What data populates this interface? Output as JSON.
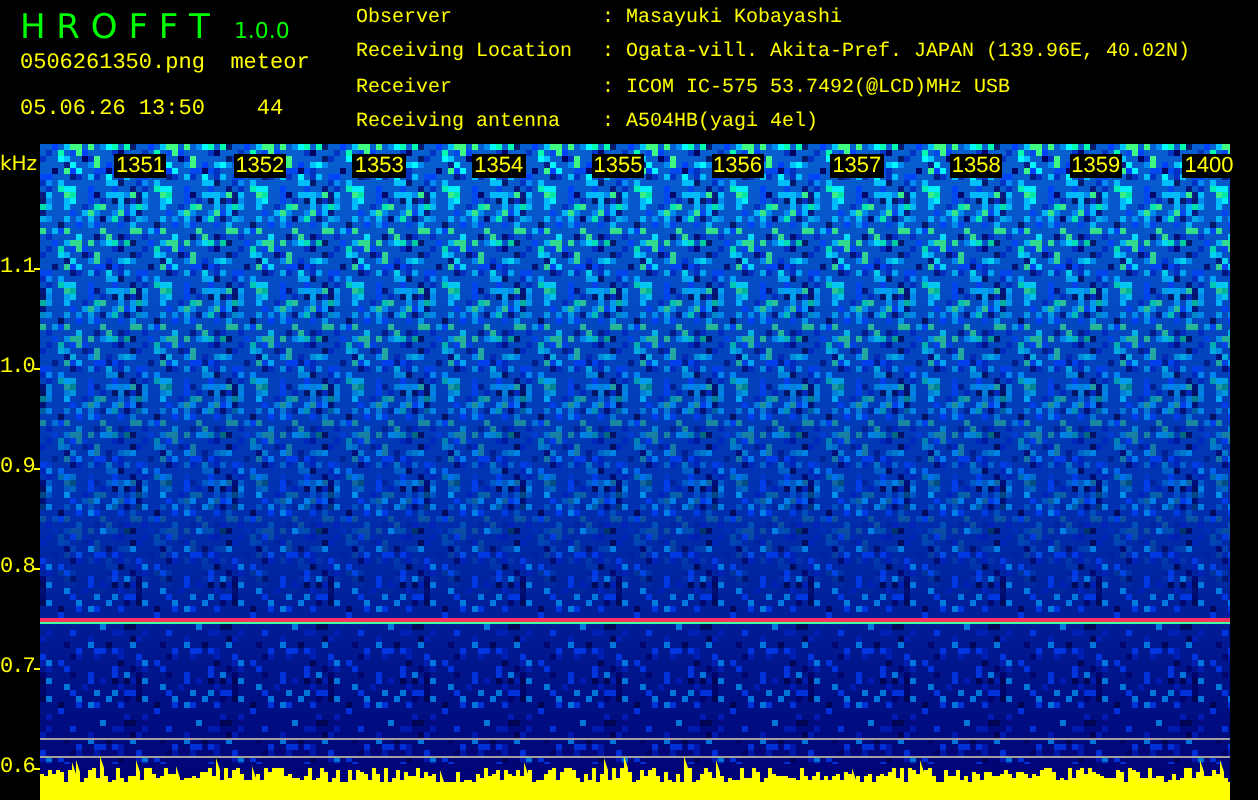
{
  "app": {
    "name": "H R O F F T",
    "version": "1.0.0"
  },
  "file": "0506261350.png",
  "timestamp": "05.06.26 13:50",
  "meteor": {
    "label": "meteor",
    "count": "44"
  },
  "info": [
    {
      "label": "Observer",
      "sep": ":",
      "value": "Masayuki Kobayashi"
    },
    {
      "label": "Receiving Location",
      "sep": ":",
      "value": "Ogata-vill. Akita-Pref. JAPAN (139.96E, 40.02N)"
    },
    {
      "label": "Receiver",
      "sep": ":",
      "value": "ICOM IC-575 53.7492(@LCD)MHz USB"
    },
    {
      "label": "Receiving antenna",
      "sep": ":",
      "value": "A504HB(yagi 4el)"
    }
  ],
  "spectrogram": {
    "unit": "kHz",
    "frequency_labels": [
      "1.1",
      "1.0",
      "0.9",
      "0.8",
      "0.7",
      "0.6"
    ],
    "time_labels": [
      "1351",
      "1352",
      "1353",
      "1354",
      "1355",
      "1356",
      "1357",
      "1358",
      "1359",
      "1400"
    ]
  }
}
